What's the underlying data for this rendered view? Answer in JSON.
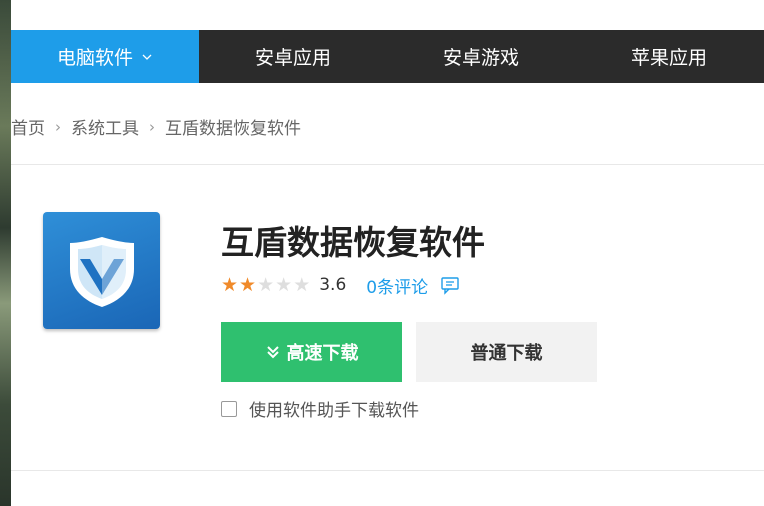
{
  "nav": {
    "items": [
      {
        "label": "电脑软件"
      },
      {
        "label": "安卓应用"
      },
      {
        "label": "安卓游戏"
      },
      {
        "label": "苹果应用"
      }
    ]
  },
  "breadcrumb": {
    "home": "首页",
    "category": "系统工具",
    "current": "互盾数据恢复软件"
  },
  "app": {
    "name": "互盾数据恢复软件",
    "rating": 3.6,
    "rating_text": "3.6",
    "stars_filled": 2,
    "stars_total": 5,
    "comments": "0条评论"
  },
  "buttons": {
    "fast_download": "高速下载",
    "normal_download": "普通下载"
  },
  "helper": {
    "label": "使用软件助手下载软件",
    "checked": false
  },
  "colors": {
    "nav_bg": "#2b2b2b",
    "nav_active": "#1e9de9",
    "fast_button": "#2fc06f",
    "star_on": "#f08a2a",
    "link": "#1e9de9"
  },
  "icons": {
    "app": "shield-v-icon",
    "comment": "comment-icon",
    "dropdown": "chevron-down-icon",
    "fast": "double-chevron-down-icon"
  }
}
